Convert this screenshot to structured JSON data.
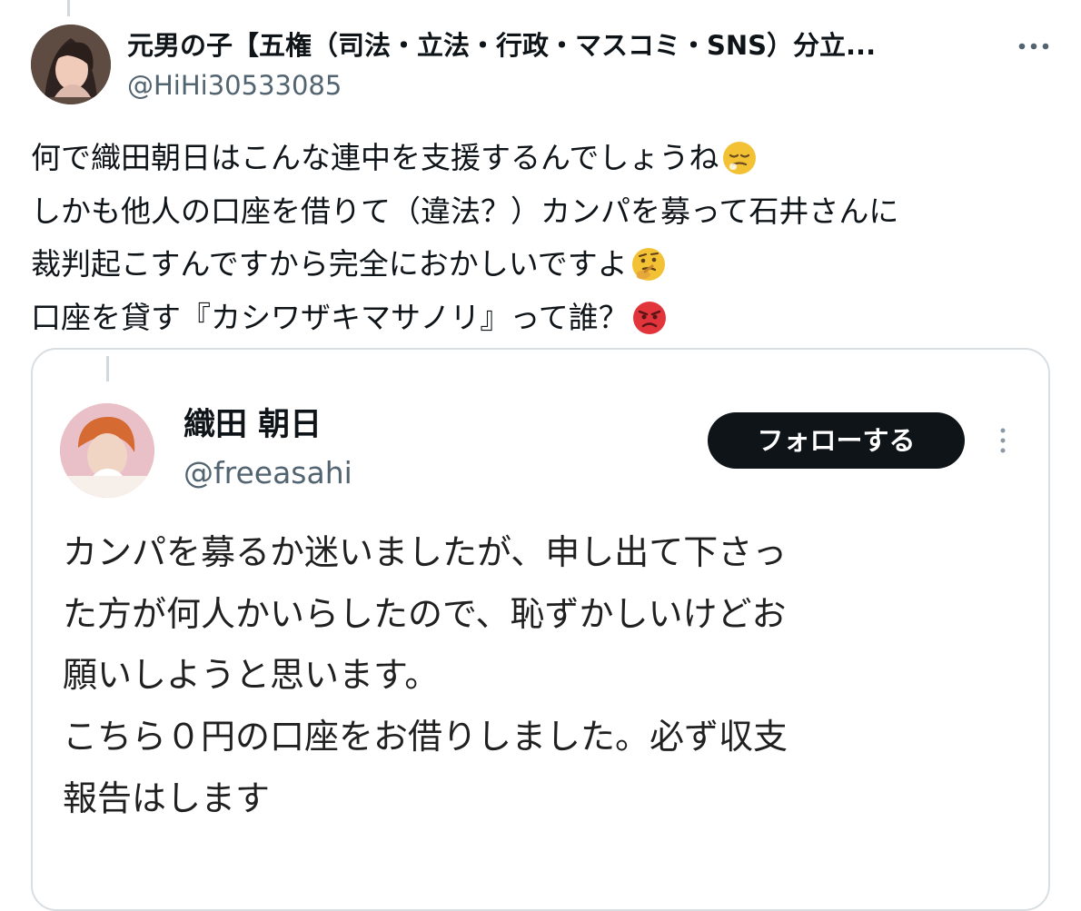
{
  "tweet": {
    "author": {
      "display_name": "元男の子【五権（司法・立法・行政・マスコミ・SNS）分立...",
      "handle": "@HiHi30533085"
    },
    "body_lines": [
      {
        "text": "何で織田朝日はこんな連中を支援するんでしょうね",
        "emoji": "relieved-face"
      },
      {
        "text": "しかも他人の口座を借りて（違法？）カンパを募って石井さんに",
        "emoji": ""
      },
      {
        "text": "裁判起こすんですから完全におかしいですよ",
        "emoji": "thinking-face"
      },
      {
        "text": "口座を貸す『カシワザキマサノリ』って誰？",
        "emoji": "angry-face"
      }
    ]
  },
  "quoted": {
    "author": {
      "display_name": "織田 朝日",
      "handle": "@freeasahi"
    },
    "follow_label": "フォローする",
    "body_lines": [
      "カンパを募るか迷いましたが、申し出て下さっ",
      "た方が何人かいらしたので、恥ずかしいけどお",
      "願いしようと思います。",
      "こちら０円の口座をお借りしました。必ず収支",
      "報告はします"
    ]
  },
  "colors": {
    "text": "#0f1419",
    "secondary_text": "#536471",
    "border": "#d8dee2",
    "button": "#0f1419",
    "emoji_face": "#f3c234",
    "emoji_angry": "#e2353b"
  }
}
